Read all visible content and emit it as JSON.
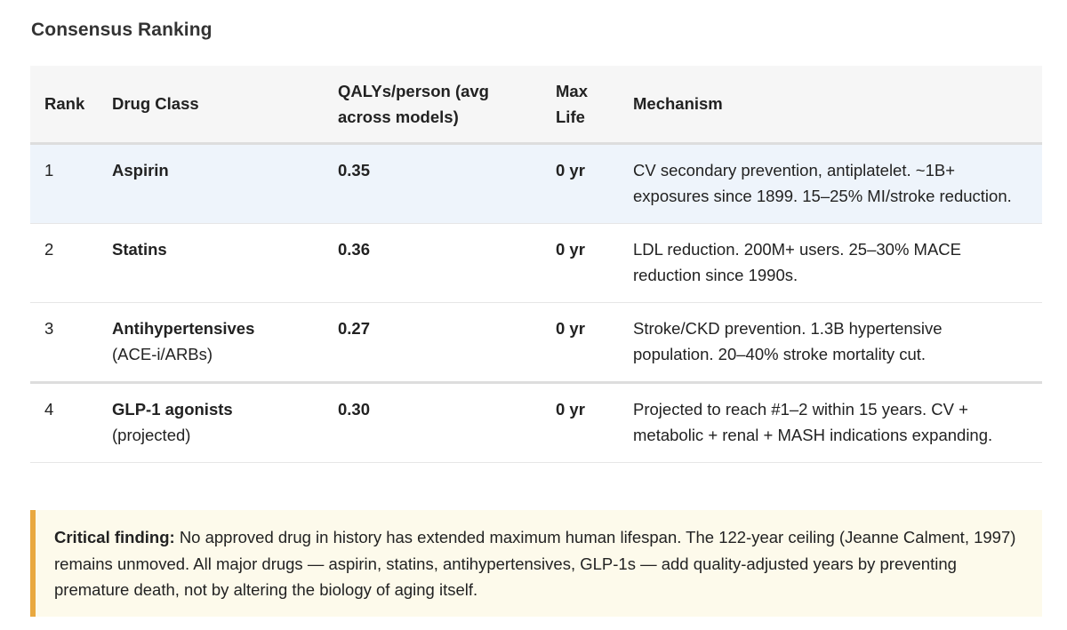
{
  "section_title": "Consensus Ranking",
  "table": {
    "headers": {
      "rank": "Rank",
      "drug_class": "Drug Class",
      "qalys": "QALYs/person (avg across models)",
      "max_life": "Max Life",
      "mechanism": "Mechanism"
    },
    "rows": [
      {
        "rank": "1",
        "drug": "Aspirin",
        "drug_sub": "",
        "qalys": "0.35",
        "max_life": "0 yr",
        "mechanism": "CV secondary prevention, antiplatelet. ~1B+ exposures since 1899. 15–25% MI/stroke reduction."
      },
      {
        "rank": "2",
        "drug": "Statins",
        "drug_sub": "",
        "qalys": "0.36",
        "max_life": "0 yr",
        "mechanism": "LDL reduction. 200M+ users. 25–30% MACE reduction since 1990s."
      },
      {
        "rank": "3",
        "drug": "Antihypertensives",
        "drug_sub": "(ACE-i/ARBs)",
        "qalys": "0.27",
        "max_life": "0 yr",
        "mechanism": "Stroke/CKD prevention. 1.3B hypertensive population. 20–40% stroke mortality cut."
      },
      {
        "rank": "4",
        "drug": "GLP-1 agonists",
        "drug_sub": "(projected)",
        "qalys": "0.30",
        "max_life": "0 yr",
        "mechanism": "Projected to reach #1–2 within 15 years. CV + metabolic + renal + MASH indications expanding."
      }
    ]
  },
  "callout": {
    "label": "Critical finding:",
    "text": "No approved drug in history has extended maximum human lifespan. The 122-year ceiling (Jeanne Calment, 1997) remains unmoved. All major drugs — aspirin, statins, antihypertensives, GLP-1s — add quality-adjusted years by preventing premature death, not by altering the biology of aging itself."
  },
  "colors": {
    "highlight_row": "#eef4fb",
    "header_bg": "#f6f6f6",
    "callout_bg": "#fdfaeb",
    "callout_border": "#e9a83f"
  }
}
